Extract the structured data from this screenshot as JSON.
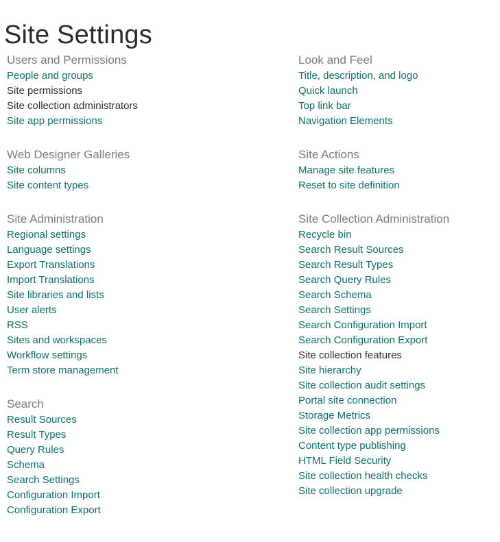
{
  "page": {
    "title": "Site Settings",
    "accent_link_color": "#106b6b",
    "visited_link_color": "#303030",
    "heading_color": "#7a7a7a",
    "title_color": "#2b2b2b",
    "background_color": "#ffffff"
  },
  "left_column": [
    {
      "heading": "Users and Permissions",
      "links": [
        {
          "label": "People and groups",
          "state": "normal"
        },
        {
          "label": "Site permissions",
          "state": "visited"
        },
        {
          "label": "Site collection administrators",
          "state": "visited"
        },
        {
          "label": "Site app permissions",
          "state": "normal"
        }
      ]
    },
    {
      "heading": "Web Designer Galleries",
      "links": [
        {
          "label": "Site columns",
          "state": "normal"
        },
        {
          "label": "Site content types",
          "state": "normal"
        }
      ]
    },
    {
      "heading": "Site Administration",
      "links": [
        {
          "label": "Regional settings",
          "state": "normal"
        },
        {
          "label": "Language settings",
          "state": "normal"
        },
        {
          "label": "Export Translations",
          "state": "normal"
        },
        {
          "label": "Import Translations",
          "state": "normal"
        },
        {
          "label": "Site libraries and lists",
          "state": "normal"
        },
        {
          "label": "User alerts",
          "state": "normal"
        },
        {
          "label": "RSS",
          "state": "normal"
        },
        {
          "label": "Sites and workspaces",
          "state": "normal"
        },
        {
          "label": "Workflow settings",
          "state": "normal"
        },
        {
          "label": "Term store management",
          "state": "normal"
        }
      ]
    },
    {
      "heading": "Search",
      "links": [
        {
          "label": "Result Sources",
          "state": "normal"
        },
        {
          "label": "Result Types",
          "state": "normal"
        },
        {
          "label": "Query Rules",
          "state": "normal"
        },
        {
          "label": "Schema",
          "state": "normal"
        },
        {
          "label": "Search Settings",
          "state": "normal"
        },
        {
          "label": "Configuration Import",
          "state": "normal"
        },
        {
          "label": "Configuration Export",
          "state": "normal"
        }
      ]
    }
  ],
  "right_column": [
    {
      "heading": "Look and Feel",
      "links": [
        {
          "label": "Title, description, and logo",
          "state": "normal"
        },
        {
          "label": "Quick launch",
          "state": "normal"
        },
        {
          "label": "Top link bar",
          "state": "normal"
        },
        {
          "label": "Navigation Elements",
          "state": "normal"
        }
      ]
    },
    {
      "heading": "Site Actions",
      "links": [
        {
          "label": "Manage site features",
          "state": "normal"
        },
        {
          "label": "Reset to site definition",
          "state": "normal"
        }
      ]
    },
    {
      "heading": "Site Collection Administration",
      "links": [
        {
          "label": "Recycle bin",
          "state": "normal"
        },
        {
          "label": "Search Result Sources",
          "state": "normal"
        },
        {
          "label": "Search Result Types",
          "state": "normal"
        },
        {
          "label": "Search Query Rules",
          "state": "normal"
        },
        {
          "label": "Search Schema",
          "state": "normal"
        },
        {
          "label": "Search Settings",
          "state": "normal"
        },
        {
          "label": "Search Configuration Import",
          "state": "normal"
        },
        {
          "label": "Search Configuration Export",
          "state": "normal"
        },
        {
          "label": "Site collection features",
          "state": "visited"
        },
        {
          "label": "Site hierarchy",
          "state": "normal"
        },
        {
          "label": "Site collection audit settings",
          "state": "normal"
        },
        {
          "label": "Portal site connection",
          "state": "normal"
        },
        {
          "label": "Storage Metrics",
          "state": "normal"
        },
        {
          "label": "Site collection app permissions",
          "state": "normal"
        },
        {
          "label": "Content type publishing",
          "state": "normal"
        },
        {
          "label": "HTML Field Security",
          "state": "normal"
        },
        {
          "label": "Site collection health checks",
          "state": "normal"
        },
        {
          "label": "Site collection upgrade",
          "state": "normal"
        }
      ]
    }
  ]
}
